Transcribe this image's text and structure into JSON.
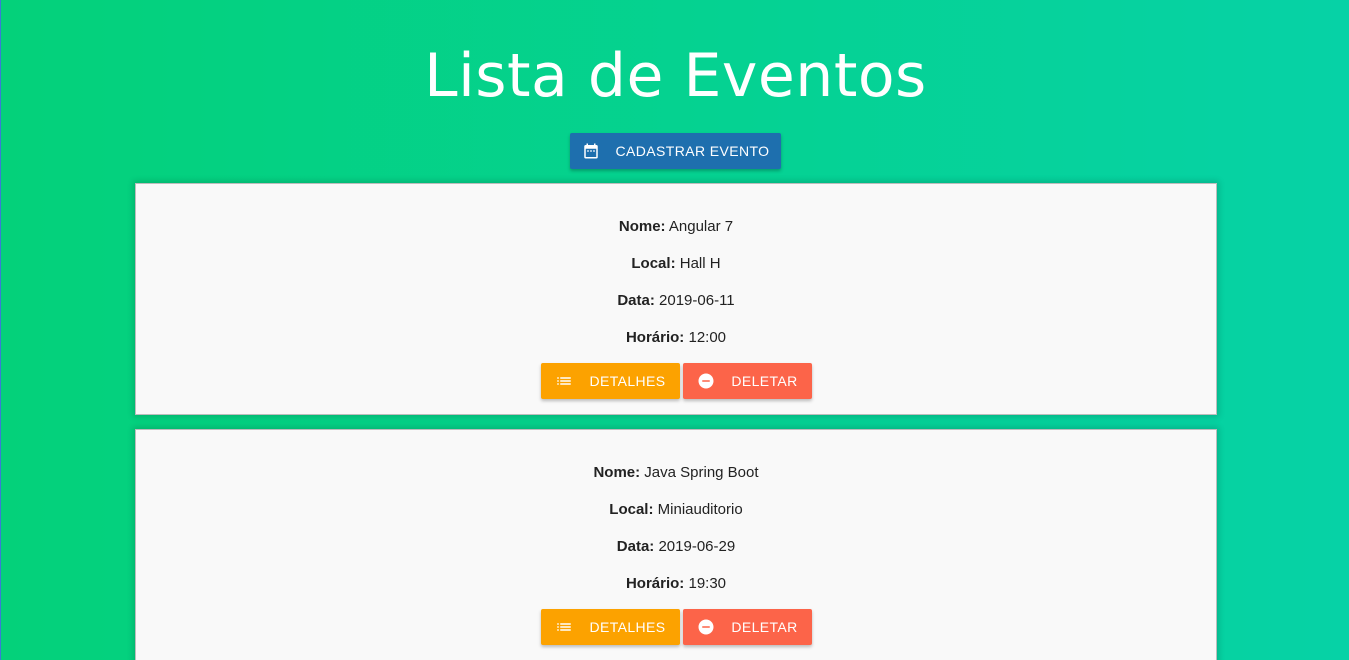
{
  "header": {
    "title": "Lista de Eventos",
    "create_button_label": "CADASTRAR EVENTO",
    "create_button_icon": "calendar-icon"
  },
  "labels": {
    "nome": "Nome:",
    "local": "Local:",
    "data": "Data:",
    "horario": "Horário:"
  },
  "events": [
    {
      "nome": "Angular 7",
      "local": "Hall H",
      "data": "2019-06-11",
      "horario": "12:00",
      "details_label": "DETALHES",
      "delete_label": "DELETAR"
    },
    {
      "nome": "Java Spring Boot",
      "local": "Miniauditorio",
      "data": "2019-06-29",
      "horario": "19:30",
      "details_label": "DETALHES",
      "delete_label": "DELETAR"
    }
  ],
  "colors": {
    "create_button": "#1e6fae",
    "details_button": "#fca200",
    "delete_button": "#fc6449",
    "card_background": "#f9f9f9"
  }
}
